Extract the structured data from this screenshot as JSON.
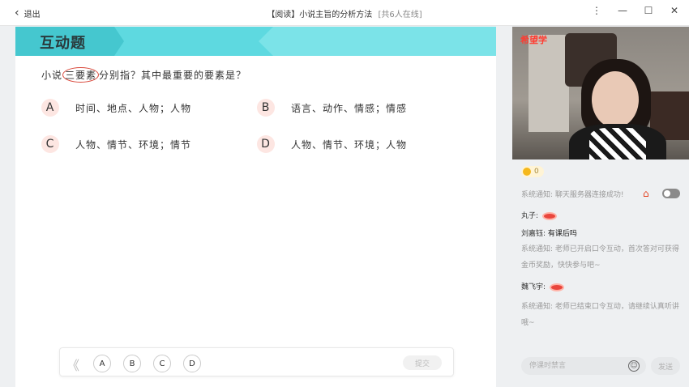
{
  "titlebar": {
    "back_label": "退出",
    "title": "【阅读】小说主旨的分析方法",
    "online": "[共6人在线]",
    "menu_glyph": "⋮",
    "minimize_glyph": "—",
    "maximize_glyph": "☐",
    "close_glyph": "✕"
  },
  "stage": {
    "banner_label": "互动题",
    "question_pre": "小说",
    "question_marked": "三要素",
    "question_post": "分别指？其中最重要的要素是？",
    "options": [
      {
        "letter": "A",
        "text": "时间、地点、人物；人物"
      },
      {
        "letter": "B",
        "text": "语言、动作、情感；情感"
      },
      {
        "letter": "C",
        "text": "人物、情节、环境；情节"
      },
      {
        "letter": "D",
        "text": "人物、情节、环境；人物"
      }
    ],
    "answer_bar": {
      "collapse_glyph": "《",
      "choices": [
        "A",
        "B",
        "C",
        "D"
      ],
      "submit_label": "提交"
    }
  },
  "sidebar": {
    "video_brand": "希望学",
    "coin_count": "0",
    "chat": {
      "system_connect": "系统通知: 聊天服务器连接成功!",
      "user1_name": "丸子:",
      "user2_name": "刘嘉钰:",
      "user2_msg": "有课后吗",
      "system_open": "系统通知: 老师已开启口令互动，首次答对可获得金币奖励，快快参与吧~",
      "user3_name": "魏飞宇:",
      "system_close": "系统通知: 老师已结束口令互动，请继续认真听讲哦~"
    },
    "input_placeholder": "停课时禁言",
    "send_label": "发送"
  },
  "colors": {
    "banner": "#5ed9e0",
    "option_badge": "#fde6e2",
    "highlight_ring": "#d9473a"
  }
}
